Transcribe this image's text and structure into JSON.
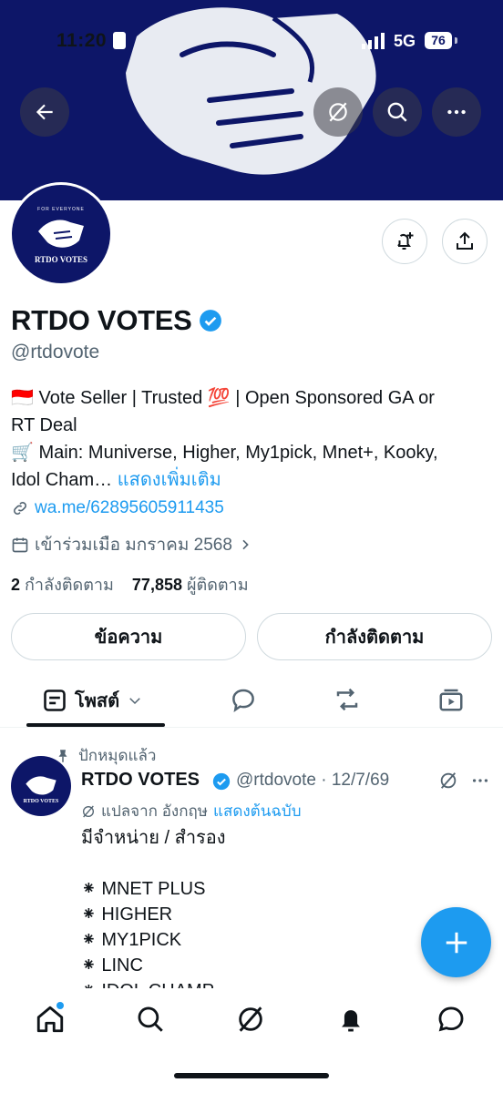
{
  "status_bar": {
    "time": "11:20",
    "network": "5G",
    "battery": "76"
  },
  "header": {
    "icons": {
      "back": "arrow-left-icon",
      "grok": "grok-icon",
      "search": "search-icon",
      "more": "more-horizontal-icon"
    }
  },
  "profile": {
    "avatar_text": {
      "tagline": "FOR EVERYONE",
      "name": "RTDO VOTES"
    },
    "name": "RTDO VOTES",
    "handle": "@rtdovote",
    "bio": {
      "line1": "🇮🇩 Vote Seller | Trusted 💯 | Open Sponsored GA or",
      "line2": "RT Deal",
      "line3": "🛒 Main: Muniverse, Higher, My1pick, Mnet+, Kooky,",
      "line4": "Idol Cham…",
      "more": "แสดงเพิ่มเติม"
    },
    "link": "wa.me/62895605911435",
    "joined": "เข้าร่วมเมือ มกราคม 2568",
    "following_count": "2",
    "following_label": "กำลังติดตาม",
    "followers_count": "77,858",
    "followers_label": "ผู้ติดตาม"
  },
  "actions": {
    "message": "ข้อความ",
    "following": "กำลังติดตาม"
  },
  "tabs": {
    "posts": "โพสต์"
  },
  "post": {
    "pinned_label": "ปักหมุดแล้ว",
    "author": "RTDO VOTES",
    "handle_date": "@rtdovote · 12/7/69",
    "translated_label": "แปลจาก อังกฤษ",
    "show_original": "แสดงต้นฉบับ",
    "lines": [
      "มีจำหน่าย / สำรอง",
      "",
      "⁕ MNET PLUS",
      "⁕ HIGHER",
      "⁕ MY1PICK",
      "⁕ LINC",
      "⁕ IDOL CHAMP"
    ]
  },
  "colors": {
    "banner": "#0d1668",
    "accent": "#1d9bf0",
    "text": "#0f1419",
    "muted": "#536471"
  }
}
